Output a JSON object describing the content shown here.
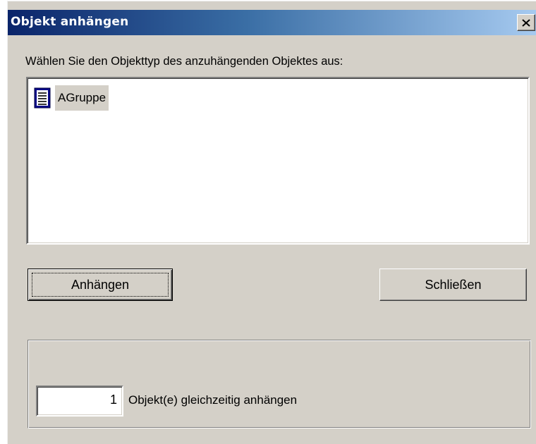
{
  "dialog": {
    "title": "Objekt anhängen",
    "close_symbol": "×",
    "prompt": "Wählen Sie den Objekttyp des anzuhängenden Objektes aus:"
  },
  "object_list": {
    "items": [
      {
        "label": "AGruppe",
        "icon": "document-icon",
        "selected": true
      }
    ]
  },
  "buttons": {
    "attach_label": "Anhängen",
    "close_label": "Schließen"
  },
  "count": {
    "value": "1",
    "label": "Objekt(e) gleichzeitig anhängen"
  },
  "colors": {
    "face": "#d4d0c8",
    "title_start": "#0a246a",
    "title_end": "#a6caf0",
    "selection": "#d4d0c8"
  }
}
